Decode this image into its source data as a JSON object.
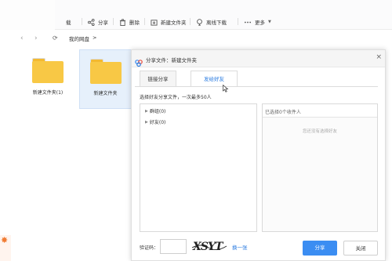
{
  "toolbar": {
    "items": [
      {
        "label": "载",
        "icon": "download-icon"
      },
      {
        "label": "分享",
        "icon": "share-icon"
      },
      {
        "label": "删除",
        "icon": "trash-icon"
      },
      {
        "label": "新建文件夹",
        "icon": "new-folder-icon"
      },
      {
        "label": "离线下载",
        "icon": "offline-download-icon"
      },
      {
        "label": "更多",
        "icon": "more-icon"
      }
    ]
  },
  "nav": {
    "back": "‹",
    "forward": "›",
    "refresh": "⟳",
    "breadcrumb": "我的网盘",
    "breadcrumb_sep": ">"
  },
  "files": [
    {
      "name": "新建文件夹(1)",
      "selected": false
    },
    {
      "name": "新建文件夹",
      "selected": true
    }
  ],
  "dialog": {
    "title": "分享文件：新建文件夹",
    "close": "×",
    "tabs": [
      {
        "label": "链接分享",
        "active": false
      },
      {
        "label": "发给好友",
        "active": true
      }
    ],
    "hint": "选择好友分享文件，一次最多50人",
    "tree": [
      {
        "label": "群组(0)"
      },
      {
        "label": "好友(0)"
      }
    ],
    "selected_header": "已选择0个收件人",
    "selected_empty": "您还没有选择好友",
    "captcha_label": "验证码：",
    "captcha_value": "",
    "captcha_text": "XSYT",
    "captcha_refresh": "换一张",
    "share_button": "分享",
    "close_button": "关闭"
  },
  "colors": {
    "accent": "#2a7be0",
    "primary_button": "#3b8df2",
    "folder": "#f8c845"
  }
}
